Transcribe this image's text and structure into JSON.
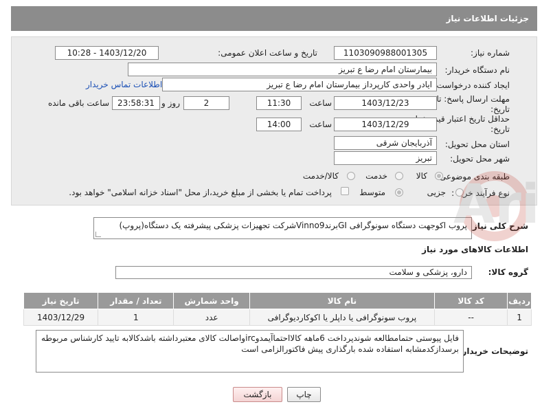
{
  "header": {
    "title": "جزئیات اطلاعات نیاز"
  },
  "form": {
    "need_number_label": "شماره نیاز:",
    "need_number": "1103090988001305",
    "announce_label": "تاریخ و ساعت اعلان عمومی:",
    "announce_value": "1403/12/20 - 10:28",
    "buyer_label": "نام دستگاه خریدار:",
    "buyer_value": "بیمارستان امام رضا  ع  تبریز",
    "creator_label": "ایجاد کننده درخواست:",
    "creator_value": "ایادر واحدی کارپرداز بیمارستان امام رضا  ع  تبریز",
    "contact_link": "اطلاعات تماس خریدار",
    "deadline_label_1": "مهلت ارسال پاسخ: تا",
    "deadline_label_2": "تاریخ:",
    "deadline_date": "1403/12/23",
    "time_label": "ساعت",
    "deadline_time": "11:30",
    "days_value": "2",
    "days_label": "روز و",
    "remaining_time": "23:58:31",
    "remaining_label": "ساعت باقی مانده",
    "validity_label_1": "حداقل تاریخ اعتبار قیمت: تا",
    "validity_label_2": "تاریخ:",
    "validity_date": "1403/12/29",
    "validity_time_label": "ساعت",
    "validity_time": "14:00",
    "province_label": "استان محل تحویل:",
    "province_value": "آذربایجان شرقی",
    "city_label": "شهر محل تحویل:",
    "city_value": "تبریز",
    "category_label": "طبقه بندی موضوعی:",
    "category_options": [
      "کالا",
      "خدمت",
      "کالا/خدمت"
    ],
    "process_label": "نوع فرآیند خرید :",
    "process_options": [
      "جزیی",
      "متوسط"
    ],
    "treasury_note": "پرداخت تمام یا بخشی از مبلغ خرید،از محل \"اسناد خزانه اسلامی\" خواهد بود."
  },
  "description": {
    "label": "شرح کلی نیاز:",
    "text": "پروب اکوجهت دستگاه سونوگرافی GIبرندVinno9شرکت تجهیزات پزشکی پیشرفته یک دستگاه(پروپ)"
  },
  "goods": {
    "section_title": "اطلاعات کالاهای مورد نیاز",
    "group_label": "گروه کالا:",
    "group_value": "دارو، پزشکی و سلامت",
    "columns": [
      "ردیف",
      "کد کالا",
      "نام کالا",
      "واحد شمارش",
      "تعداد / مقدار",
      "تاریخ نیاز"
    ],
    "rows": [
      [
        "1",
        "--",
        "پروب سونوگرافی یا داپلر یا اکوکاردیوگرافی",
        "عدد",
        "1",
        "1403/12/29"
      ]
    ]
  },
  "buyer_notes": {
    "label": "توضیحات خریدار:",
    "text": "فایل پیوستی حتمامطالعه شوندپرداخت 6ماهه کالااحتماآیمدوircواصالت کالای معتبرداشته باشدکالابه تایید کارشناس مربوطه برسدازکدمشابه استفاده شده بارگذاری پیش فاکتورالزامی است"
  },
  "buttons": {
    "print": "چاپ",
    "back": "بازگشت"
  },
  "watermark": "AriaTender.net"
}
